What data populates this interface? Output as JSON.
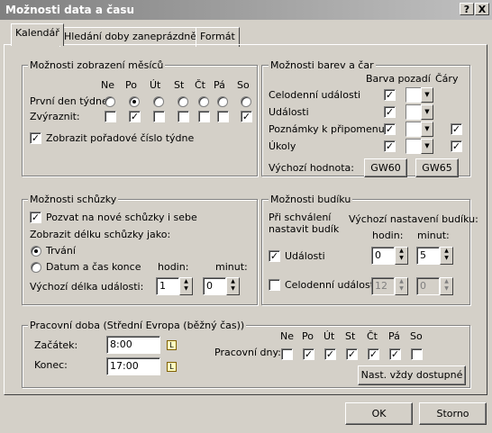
{
  "title": "Možnosti data a času",
  "titlebar": {
    "help": "?",
    "close": "X"
  },
  "tabs": [
    "Kalendář",
    "Hledání doby zaneprázdnění",
    "Formát"
  ],
  "months": {
    "group": "Možnosti zobrazení měsíců",
    "days": [
      "Ne",
      "Po",
      "Út",
      "St",
      "Čt",
      "Pá",
      "So"
    ],
    "first_day_label": "První den týdne:",
    "first_day_selected": 1,
    "highlight_label": "Zvýraznit:",
    "highlight": [
      false,
      true,
      false,
      false,
      false,
      false,
      true
    ],
    "week_numbers_label": "Zobrazit pořadové číslo týdne",
    "week_numbers": true
  },
  "colors": {
    "group": "Možnosti barev a čar",
    "col_bg": "Barva pozadí",
    "col_lines": "Čáry",
    "rows": [
      {
        "label": "Celodenní události",
        "bg": true,
        "lines": null
      },
      {
        "label": "Události",
        "bg": true,
        "lines": null
      },
      {
        "label": "Poznámky k připomenutí",
        "bg": true,
        "lines": true
      },
      {
        "label": "Úkoly",
        "bg": true,
        "lines": true
      }
    ],
    "default_label": "Výchozí hodnota:",
    "btn1": "GW60",
    "btn2": "GW65"
  },
  "meeting": {
    "group": "Možnosti schůzky",
    "invite_label": "Pozvat na nové schůzky i sebe",
    "invite": true,
    "show_length_label": "Zobrazit délku schůzky jako:",
    "radio1": "Trvání",
    "radio2": "Datum a čas konce",
    "selected": 0,
    "hours_label": "hodin:",
    "minutes_label": "minut:",
    "default_length_label": "Výchozí délka události:",
    "hours": "1",
    "minutes": "0"
  },
  "alarm": {
    "group": "Možnosti budíku",
    "approve_label_1": "Při schválení",
    "approve_label_2": "nastavit budík",
    "default_label": "Výchozí nastavení budíku:",
    "hours_label": "hodin:",
    "minutes_label": "minut:",
    "events_label": "Události",
    "events": true,
    "events_hours": "0",
    "events_minutes": "5",
    "allday_label": "Celodenní události",
    "allday": false,
    "allday_hours": "12",
    "allday_minutes": "0"
  },
  "work": {
    "group": "Pracovní doba (Střední Evropa (běžný čas))",
    "start_label": "Začátek:",
    "start": "8:00",
    "end_label": "Konec:",
    "end": "17:00",
    "days_label": "Pracovní dny:",
    "days": [
      "Ne",
      "Po",
      "Út",
      "St",
      "Čt",
      "Pá",
      "So"
    ],
    "workdays": [
      false,
      true,
      true,
      true,
      true,
      true,
      false
    ],
    "always_button": "Nast. vždy dostupné"
  },
  "footer": {
    "ok": "OK",
    "cancel": "Storno"
  }
}
